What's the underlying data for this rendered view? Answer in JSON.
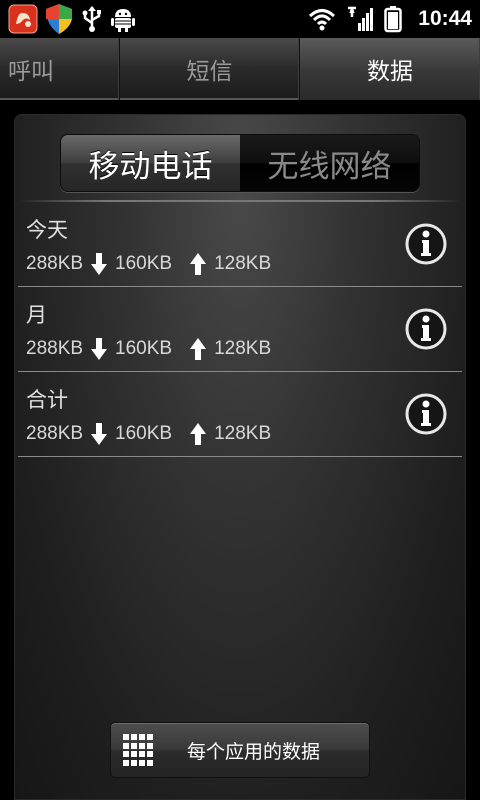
{
  "status_bar": {
    "time": "10:44",
    "icons_left": [
      "app-notification-icon",
      "shield-icon",
      "usb-icon",
      "android-debug-icon"
    ],
    "icons_right": [
      "wifi-icon",
      "signal-icon",
      "battery-icon"
    ]
  },
  "tabs": [
    {
      "label": "呼叫",
      "selected": false
    },
    {
      "label": "短信",
      "selected": false
    },
    {
      "label": "数据",
      "selected": true
    }
  ],
  "segmented": {
    "mobile": "移动电话",
    "wifi": "无线网络",
    "selected": "mobile"
  },
  "rows": [
    {
      "title": "今天",
      "total": "288KB",
      "down": "160KB",
      "up": "128KB"
    },
    {
      "title": "月",
      "total": "288KB",
      "down": "160KB",
      "up": "128KB"
    },
    {
      "title": "合计",
      "total": "288KB",
      "down": "160KB",
      "up": "128KB"
    }
  ],
  "bottom_button": {
    "label": "每个应用的数据",
    "icon": "grid-icon"
  }
}
